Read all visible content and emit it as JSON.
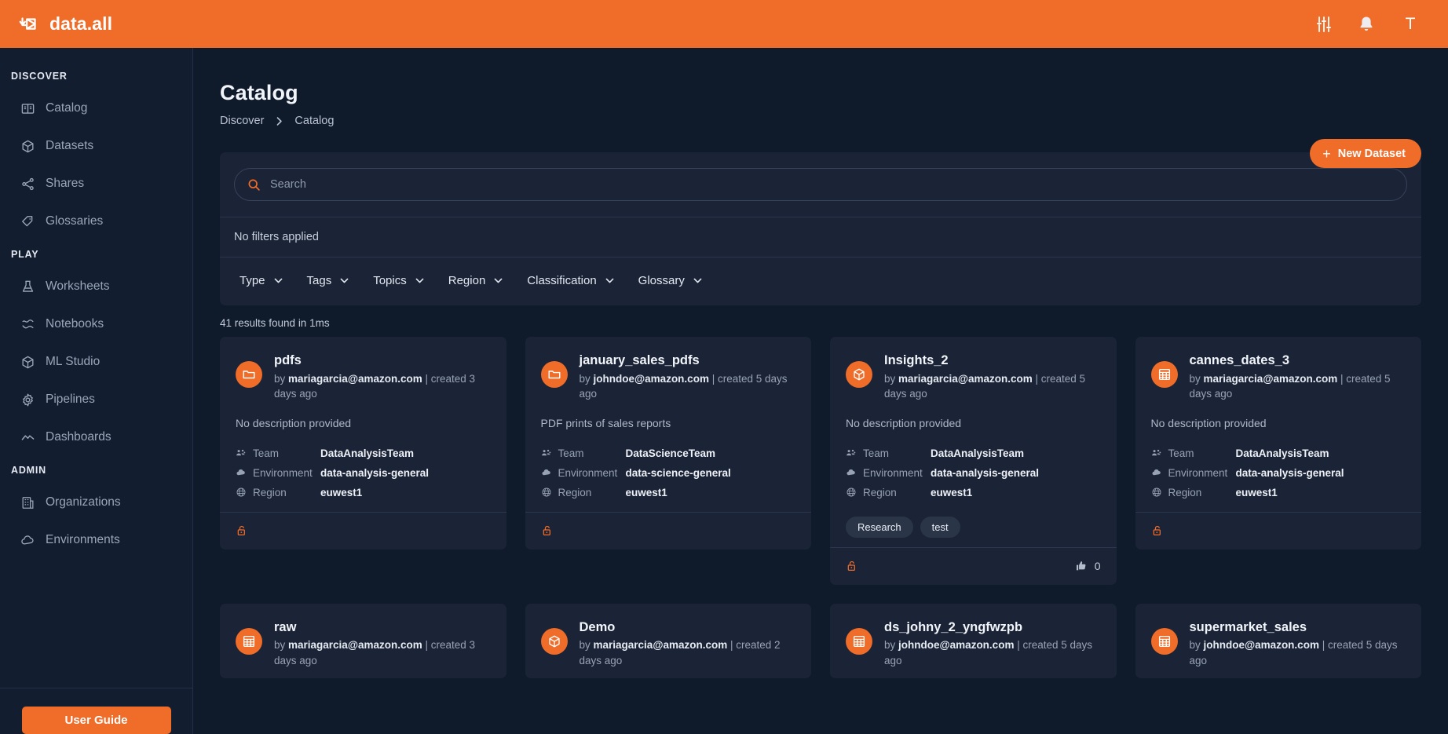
{
  "topbar": {
    "brand": "data.all",
    "icons": [
      {
        "name": "sliders-icon",
        "label": "Settings"
      },
      {
        "name": "bell-icon",
        "label": "Notifications"
      }
    ],
    "avatar_letter": "T",
    "accent_color": "#ef6c29"
  },
  "sidebar": {
    "sections": [
      {
        "title": "DISCOVER",
        "items": [
          {
            "label": "Catalog",
            "icon": "catalog-icon"
          },
          {
            "label": "Datasets",
            "icon": "box-icon"
          },
          {
            "label": "Shares",
            "icon": "share-icon"
          },
          {
            "label": "Glossaries",
            "icon": "tag-icon"
          }
        ]
      },
      {
        "title": "PLAY",
        "items": [
          {
            "label": "Worksheets",
            "icon": "flask-icon"
          },
          {
            "label": "Notebooks",
            "icon": "notebook-icon"
          },
          {
            "label": "ML Studio",
            "icon": "cube-icon"
          },
          {
            "label": "Pipelines",
            "icon": "gear-icon"
          },
          {
            "label": "Dashboards",
            "icon": "chart-line-icon"
          }
        ]
      },
      {
        "title": "ADMIN",
        "items": [
          {
            "label": "Organizations",
            "icon": "building-icon"
          },
          {
            "label": "Environments",
            "icon": "cloud-icon"
          }
        ]
      }
    ],
    "user_guide_label": "User Guide"
  },
  "header": {
    "title": "Catalog",
    "breadcrumb": [
      "Discover",
      "Catalog"
    ],
    "new_dataset_label": "New Dataset",
    "plus": "+"
  },
  "search": {
    "placeholder": "Search",
    "value": "",
    "no_filters_text": "No filters applied",
    "filters": [
      {
        "label": "Type"
      },
      {
        "label": "Tags"
      },
      {
        "label": "Topics"
      },
      {
        "label": "Region"
      },
      {
        "label": "Classification"
      },
      {
        "label": "Glossary"
      }
    ]
  },
  "results": {
    "count_text": "41 results found in 1ms",
    "meta_labels": {
      "team": "Team",
      "environment": "Environment",
      "region": "Region"
    },
    "cards": [
      {
        "title": "pdfs",
        "by_prefix": "by ",
        "author": "mariagarcia@amazon.com",
        "created": " | created 3 days ago",
        "description": "No description provided",
        "icon": "folder-icon",
        "team": "DataAnalysisTeam",
        "environment": "data-analysis-general",
        "region": "euwest1",
        "tags": [],
        "lock": "unlocked-icon",
        "upvotes": null
      },
      {
        "title": "january_sales_pdfs",
        "by_prefix": "by ",
        "author": "johndoe@amazon.com",
        "created": " | created 5 days ago",
        "description": "PDF prints of sales reports",
        "icon": "folder-icon",
        "team": "DataScienceTeam",
        "environment": "data-science-general",
        "region": "euwest1",
        "tags": [],
        "lock": "unlocked-icon",
        "upvotes": null
      },
      {
        "title": "Insights_2",
        "by_prefix": "by ",
        "author": "mariagarcia@amazon.com",
        "created": " | created 5 days ago",
        "description": "No description provided",
        "icon": "cube-icon",
        "team": "DataAnalysisTeam",
        "environment": "data-analysis-general",
        "region": "euwest1",
        "tags": [
          "Research",
          "test"
        ],
        "lock": "unlocked-icon",
        "upvotes": "0"
      },
      {
        "title": "cannes_dates_3",
        "by_prefix": "by ",
        "author": "mariagarcia@amazon.com",
        "created": " | created 5 days ago",
        "description": "No description provided",
        "icon": "table-icon",
        "team": "DataAnalysisTeam",
        "environment": "data-analysis-general",
        "region": "euwest1",
        "tags": [],
        "lock": "unlocked-icon",
        "upvotes": null
      },
      {
        "title": "raw",
        "by_prefix": "by ",
        "author": "mariagarcia@amazon.com",
        "created": " | created 3 days ago",
        "description": "",
        "icon": "table-icon",
        "team": "",
        "environment": "",
        "region": "",
        "tags": [],
        "lock": "",
        "upvotes": null
      },
      {
        "title": "Demo",
        "by_prefix": "by ",
        "author": "mariagarcia@amazon.com",
        "created": " | created 2 days ago",
        "description": "",
        "icon": "cube-icon",
        "team": "",
        "environment": "",
        "region": "",
        "tags": [],
        "lock": "",
        "upvotes": null
      },
      {
        "title": "ds_johny_2_yngfwzpb",
        "by_prefix": "by ",
        "author": "johndoe@amazon.com",
        "created": " | created 5 days ago",
        "description": "",
        "icon": "table-icon",
        "team": "",
        "environment": "",
        "region": "",
        "tags": [],
        "lock": "",
        "upvotes": null
      },
      {
        "title": "supermarket_sales",
        "by_prefix": "by ",
        "author": "johndoe@amazon.com",
        "created": " | created 5 days ago",
        "description": "",
        "icon": "table-icon",
        "team": "",
        "environment": "",
        "region": "",
        "tags": [],
        "lock": "",
        "upvotes": null
      }
    ]
  }
}
